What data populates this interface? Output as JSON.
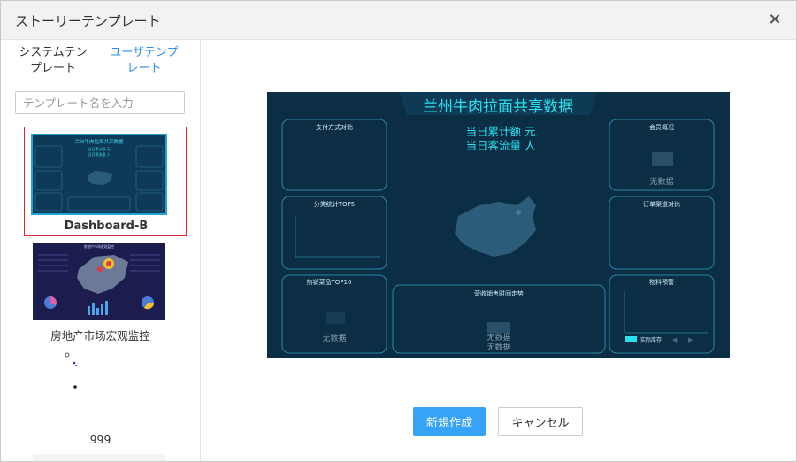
{
  "dialog": {
    "title": "ストーリーテンプレート",
    "close_icon": "×"
  },
  "sidebar": {
    "tabs": [
      {
        "label_line1": "システムテン",
        "label_line2": "プレート"
      },
      {
        "label_line1": "ユーザテンプ",
        "label_line2": "レート"
      }
    ],
    "search_placeholder": "テンプレート名を入力",
    "templates": [
      {
        "name": "Dashboard-B",
        "selected": true
      },
      {
        "name": "房地产市场宏观监控",
        "selected": false
      },
      {
        "name": "999",
        "selected": false
      },
      {
        "name": "",
        "selected": false
      }
    ]
  },
  "preview": {
    "title": "兰州牛肉拉面共享数据",
    "kpi1": "当日累计额  元",
    "kpi2": "当日客流量  人",
    "panels": {
      "payment": "支付方式对比",
      "category": "分类统计TOP5",
      "hot": "热销菜品TOP10",
      "member": "会员概况",
      "channel": "订单渠道对比",
      "trend": "营收销售时间走势",
      "stock": "物料预警"
    },
    "no_data": "无数据",
    "stock_legend": "实际库存"
  },
  "thumb1": {
    "title": "兰州牛肉拉面共享数据",
    "kpi1": "当日累计额  元",
    "kpi2": "当日客流量  人"
  },
  "thumb2": {
    "title": "房地产市场宏观监控"
  },
  "buttons": {
    "create": "新規作成",
    "cancel": "キャンセル"
  },
  "colors": {
    "accent": "#36a3f7",
    "tab_active": "#2d8cf0",
    "selected_border": "#d9262f",
    "preview_bg": "#0b2e45",
    "preview_title": "#27e0f0"
  }
}
